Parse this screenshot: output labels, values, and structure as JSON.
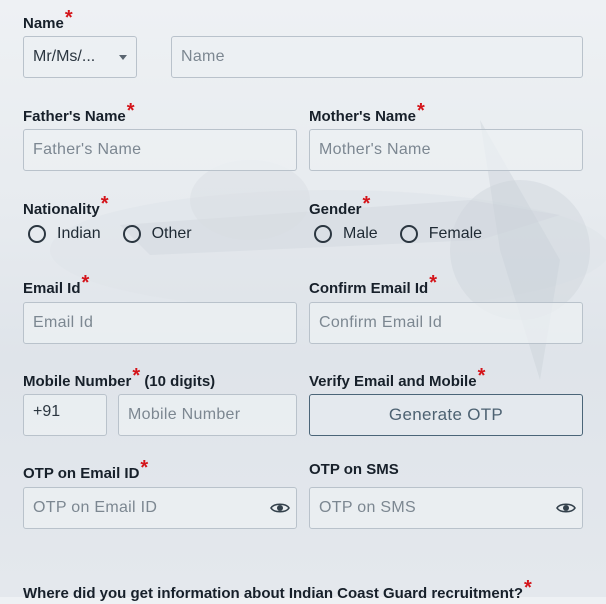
{
  "required_mark": "*",
  "name": {
    "label": "Name",
    "title_select": {
      "value": "Mr/Ms/..."
    },
    "input_placeholder": "Name"
  },
  "father": {
    "label": "Father's Name",
    "placeholder": "Father's Name"
  },
  "mother": {
    "label": "Mother's Name",
    "placeholder": "Mother's Name"
  },
  "nationality": {
    "label": "Nationality",
    "options": [
      "Indian",
      "Other"
    ]
  },
  "gender": {
    "label": "Gender",
    "options": [
      "Male",
      "Female"
    ]
  },
  "email": {
    "label": "Email Id",
    "placeholder": "Email Id"
  },
  "confirm_email": {
    "label": "Confirm Email Id",
    "placeholder": "Confirm Email Id"
  },
  "mobile": {
    "label": "Mobile Number",
    "label_suffix": "(10 digits)",
    "prefix": "+91",
    "placeholder": "Mobile Number"
  },
  "verify": {
    "label": "Verify Email and Mobile",
    "button": "Generate OTP"
  },
  "otp_email": {
    "label": "OTP on Email ID",
    "placeholder": "OTP on Email ID",
    "icon": "eye-icon"
  },
  "otp_sms": {
    "label": "OTP on SMS",
    "placeholder": "OTP on SMS",
    "icon": "eye-icon"
  },
  "source_question": {
    "label": "Where did you get information about Indian Coast Guard recruitment?"
  },
  "colors": {
    "required": "#d4141a",
    "border": "#b9c2cb",
    "button_border": "#4b6578"
  }
}
